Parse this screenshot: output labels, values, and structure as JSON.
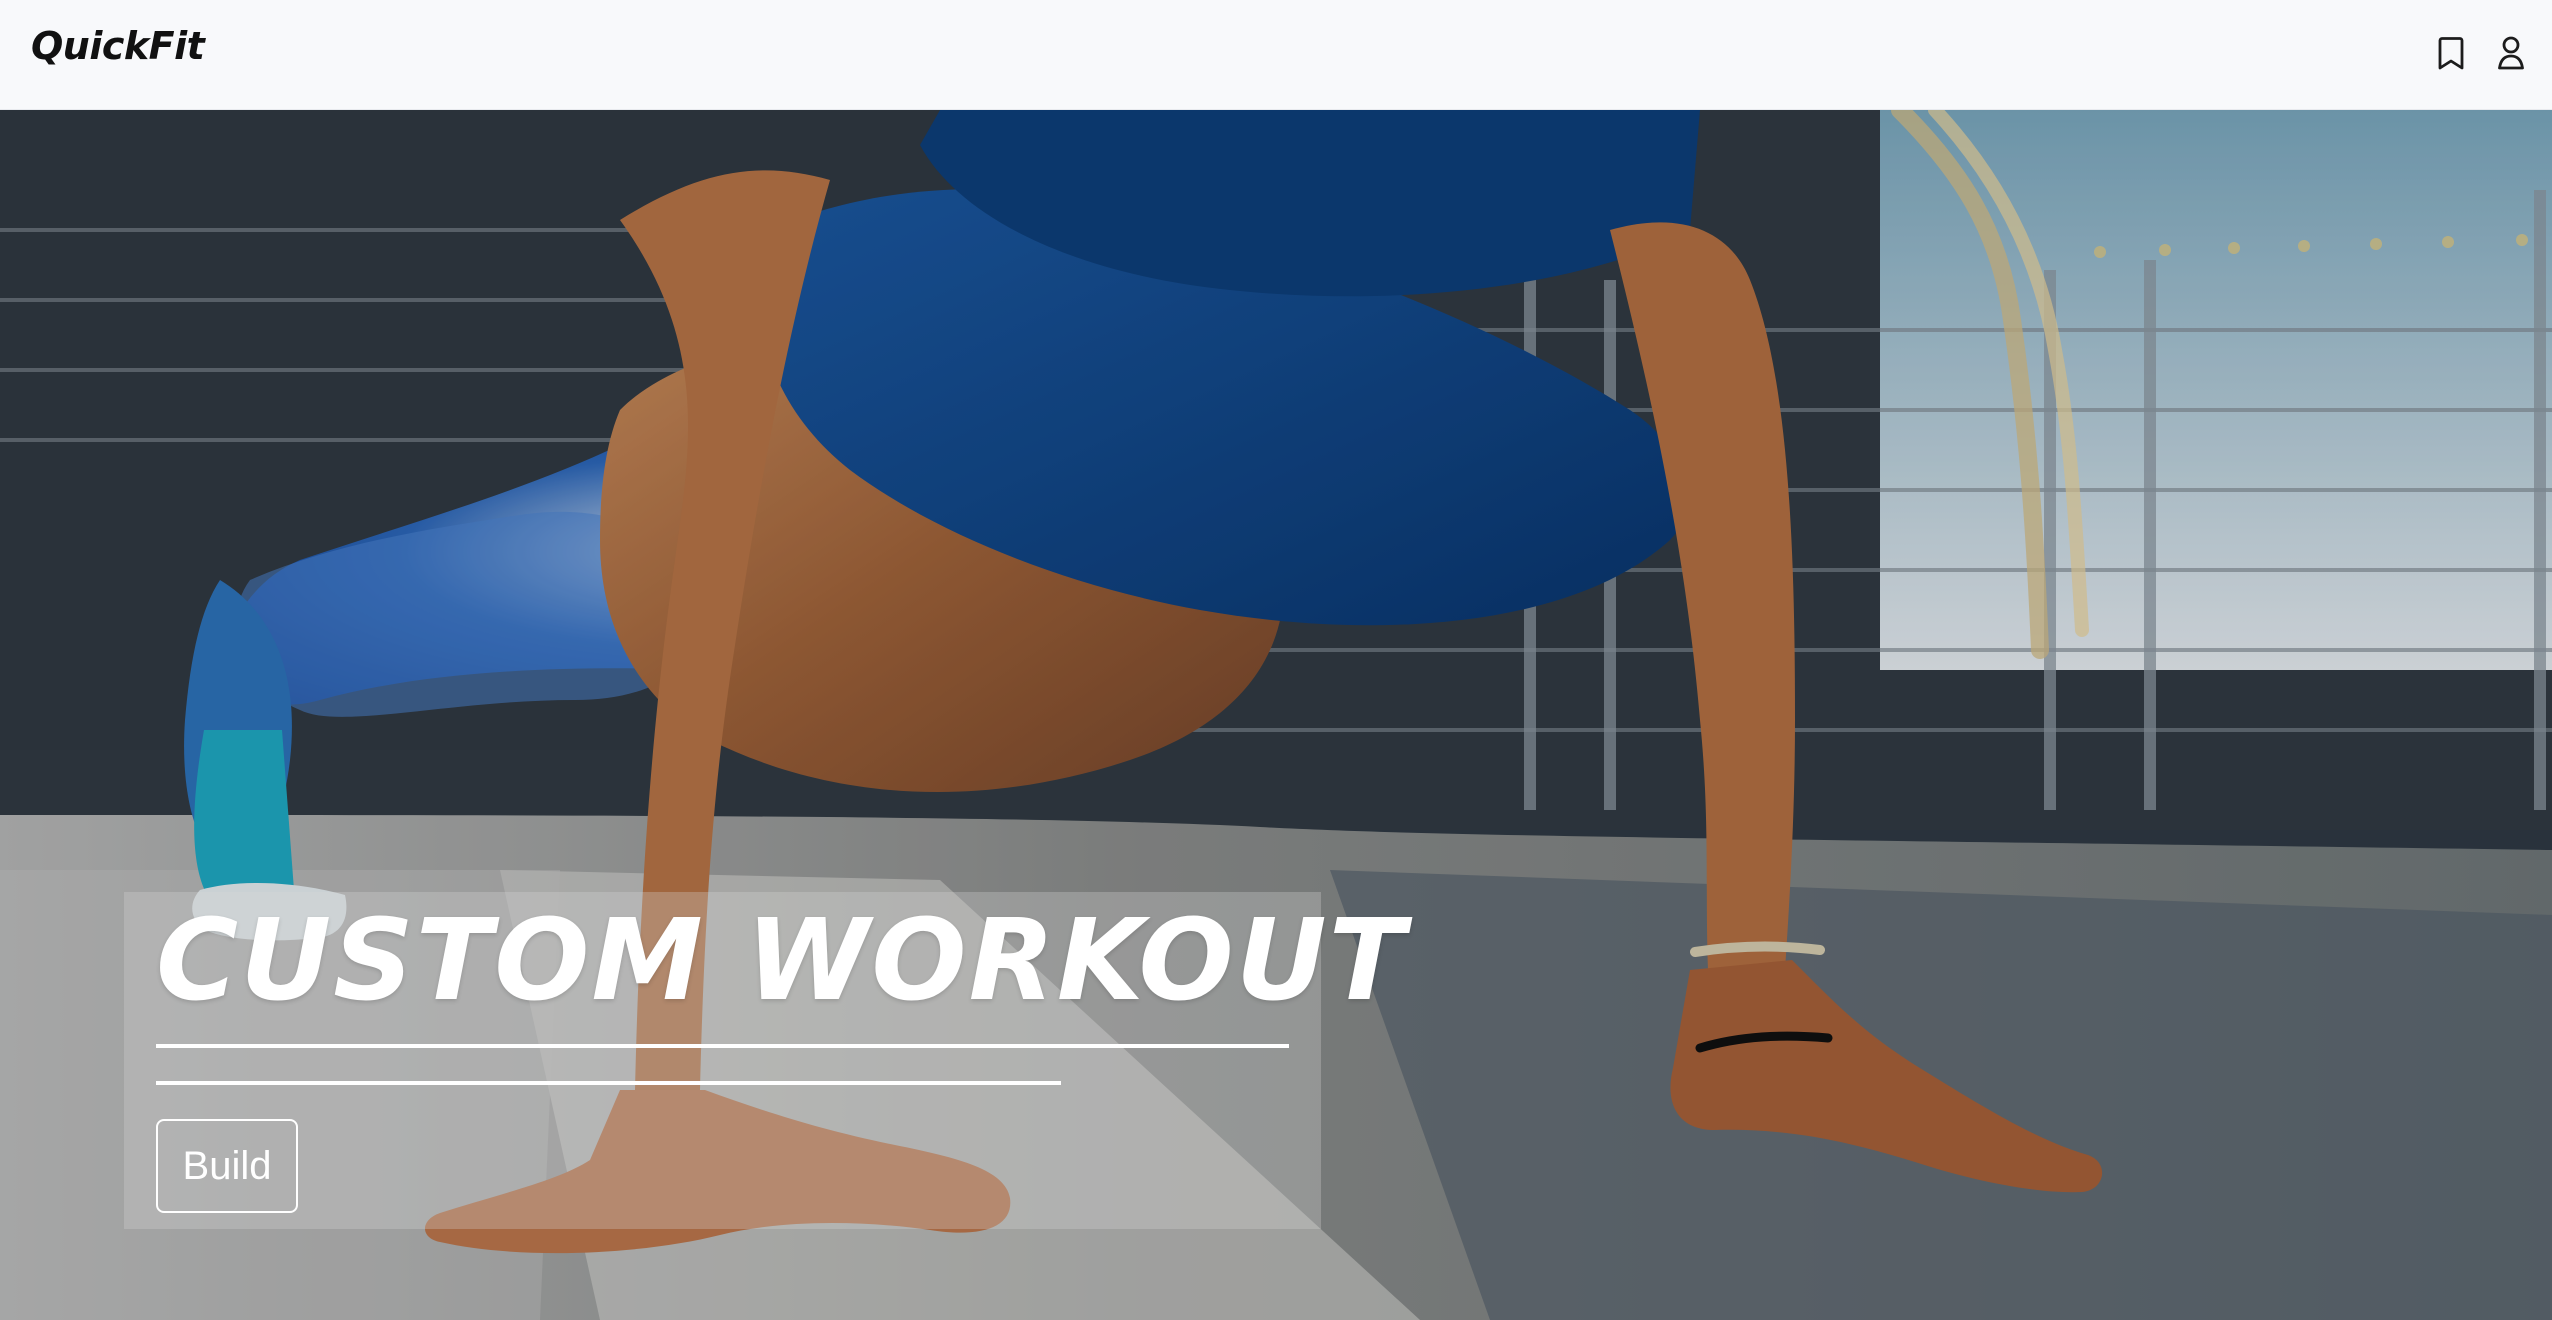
{
  "brand": {
    "name": "QuickFit"
  },
  "header": {
    "icons": [
      "bookmark-icon",
      "user-icon"
    ]
  },
  "hero": {
    "title": "CUSTOM WORKOUT",
    "cta_label": "Build"
  },
  "colors": {
    "header_background": "#f8f9fb",
    "hero_text": "#ffffff",
    "panel_overlay": "rgba(214, 214, 214, 0.30)"
  }
}
